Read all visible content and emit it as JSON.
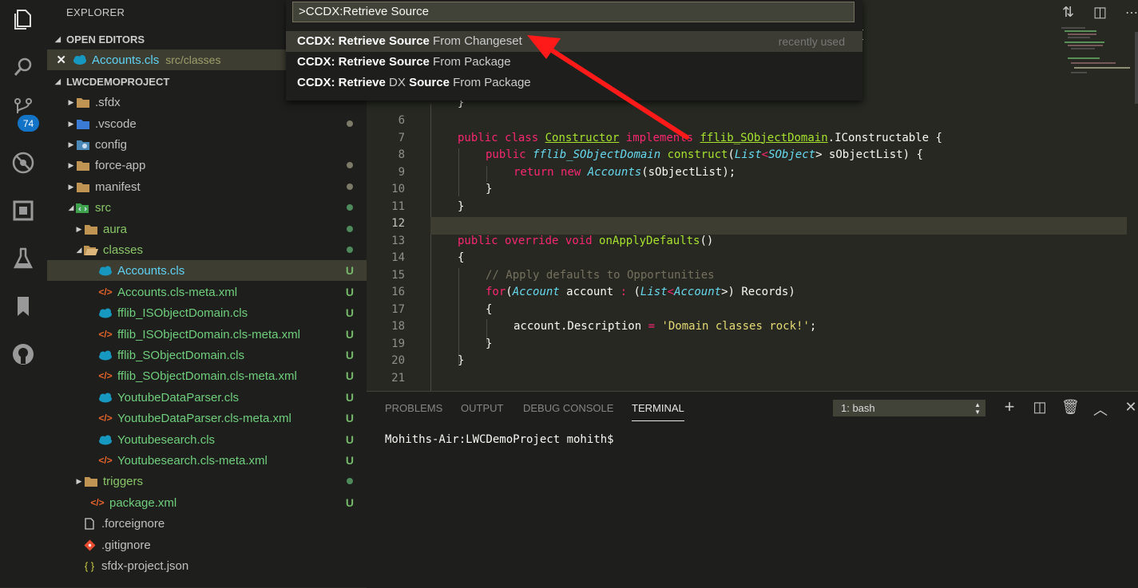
{
  "activity_bar": {
    "icons": [
      "files-icon",
      "search-icon",
      "source-control-icon",
      "debug-icon",
      "extensions-icon",
      "test-icon",
      "bookmark-icon",
      "github-icon"
    ],
    "scm_badge": "74"
  },
  "sidebar": {
    "title": "EXPLORER",
    "open_editors_label": "OPEN EDITORS",
    "open_editor": {
      "name": "Accounts.cls",
      "path": "src/classes"
    },
    "project_label": "LWCDEMOPROJECT",
    "tree": [
      {
        "label": ".sfdx",
        "status": "",
        "dot": ""
      },
      {
        "label": ".vscode",
        "status": "",
        "dot": "#7d7a68"
      },
      {
        "label": "config",
        "status": "",
        "dot": ""
      },
      {
        "label": "force-app",
        "status": "",
        "dot": "#7d7a68"
      },
      {
        "label": "manifest",
        "status": "",
        "dot": "#7d7a68"
      },
      {
        "label": "src",
        "status": "",
        "dot": "#4e8a5c"
      },
      {
        "label": "aura",
        "status": "",
        "dot": "#4e8a5c"
      },
      {
        "label": "classes",
        "status": "",
        "dot": "#4e8a5c"
      },
      {
        "label": "Accounts.cls",
        "status": "U",
        "dot": ""
      },
      {
        "label": "Accounts.cls-meta.xml",
        "status": "U",
        "dot": ""
      },
      {
        "label": "fflib_ISObjectDomain.cls",
        "status": "U",
        "dot": ""
      },
      {
        "label": "fflib_ISObjectDomain.cls-meta.xml",
        "status": "U",
        "dot": ""
      },
      {
        "label": "fflib_SObjectDomain.cls",
        "status": "U",
        "dot": ""
      },
      {
        "label": "fflib_SObjectDomain.cls-meta.xml",
        "status": "U",
        "dot": ""
      },
      {
        "label": "YoutubeDataParser.cls",
        "status": "U",
        "dot": ""
      },
      {
        "label": "YoutubeDataParser.cls-meta.xml",
        "status": "U",
        "dot": ""
      },
      {
        "label": "Youtubesearch.cls",
        "status": "U",
        "dot": ""
      },
      {
        "label": "Youtubesearch.cls-meta.xml",
        "status": "U",
        "dot": ""
      },
      {
        "label": "triggers",
        "status": "",
        "dot": "#4e8a5c"
      },
      {
        "label": "package.xml",
        "status": "U",
        "dot": ""
      },
      {
        "label": ".forceignore",
        "status": "",
        "dot": ""
      },
      {
        "label": ".gitignore",
        "status": "",
        "dot": ""
      },
      {
        "label": "sfdx-project.json",
        "status": "",
        "dot": ""
      }
    ]
  },
  "quick_pick": {
    "input_value": ">CCDX:Retrieve Source",
    "items": [
      {
        "bold1": "CCDX: Retrieve Source",
        "rest": " From Changeset",
        "hint": "recently used"
      },
      {
        "bold1": "CCDX: Retrieve Source",
        "rest": " From Package",
        "hint": ""
      },
      {
        "bold1": "CCDX: Retrieve",
        "mid": " DX ",
        "bold2": "Source",
        "rest": " From Package",
        "hint": ""
      }
    ]
  },
  "editor": {
    "line_numbers": [
      "6",
      "7",
      "8",
      "9",
      "10",
      "11",
      "12",
      "13",
      "14",
      "15",
      "16",
      "17",
      "18",
      "19",
      "20",
      "21"
    ],
    "partial_brace_top": "{",
    "partial_close": "}",
    "code": {
      "l6": "",
      "l7": {
        "kw1": "public",
        "kw2": "class",
        "name": "Constructor",
        "kw3": "implements",
        "iface": "fflib_SObjectDomain",
        "rest": ".IConstructable {"
      },
      "l8": {
        "kw": "public",
        "type": "fflib_SObjectDomain",
        "fn": "construct",
        "p1": "(",
        "t1": "List",
        "lt": "<",
        "t2": "SObject",
        "rest": "> sObjectList) {"
      },
      "l9": {
        "kw1": "return",
        "kw2": "new",
        "type": "Accounts",
        "rest": "(sObjectList);"
      },
      "l10": "}",
      "l11": "}",
      "l12": "",
      "l13": {
        "kw1": "public",
        "kw2": "override",
        "kw3": "void",
        "fn": "onApplyDefaults",
        "rest": "()"
      },
      "l14": "{",
      "l15": "// Apply defaults to Opportunities",
      "l16": {
        "kw": "for",
        "p1": "(",
        "t1": "Account",
        "mid": " account ",
        "colon": ":",
        "p2": " (",
        "t2": "List",
        "lt": "<",
        "t3": "Account",
        "rest": ">) Records)"
      },
      "l17": "{",
      "l18": {
        "pre": "account.Description ",
        "eq": "=",
        "str": "'Domain classes rock!'",
        "rest": ";"
      },
      "l19": "}",
      "l20": "}",
      "l21": ""
    }
  },
  "panel": {
    "tabs": [
      "PROBLEMS",
      "OUTPUT",
      "DEBUG CONSOLE",
      "TERMINAL"
    ],
    "active_tab": "TERMINAL",
    "terminal_select": "1: bash",
    "terminal_text": "Mohiths-Air:LWCDemoProject mohith$"
  },
  "colors": {
    "accent_red": "#ff1a1a",
    "badge_blue": "#1273c7",
    "untracked_green": "#75b86a"
  }
}
